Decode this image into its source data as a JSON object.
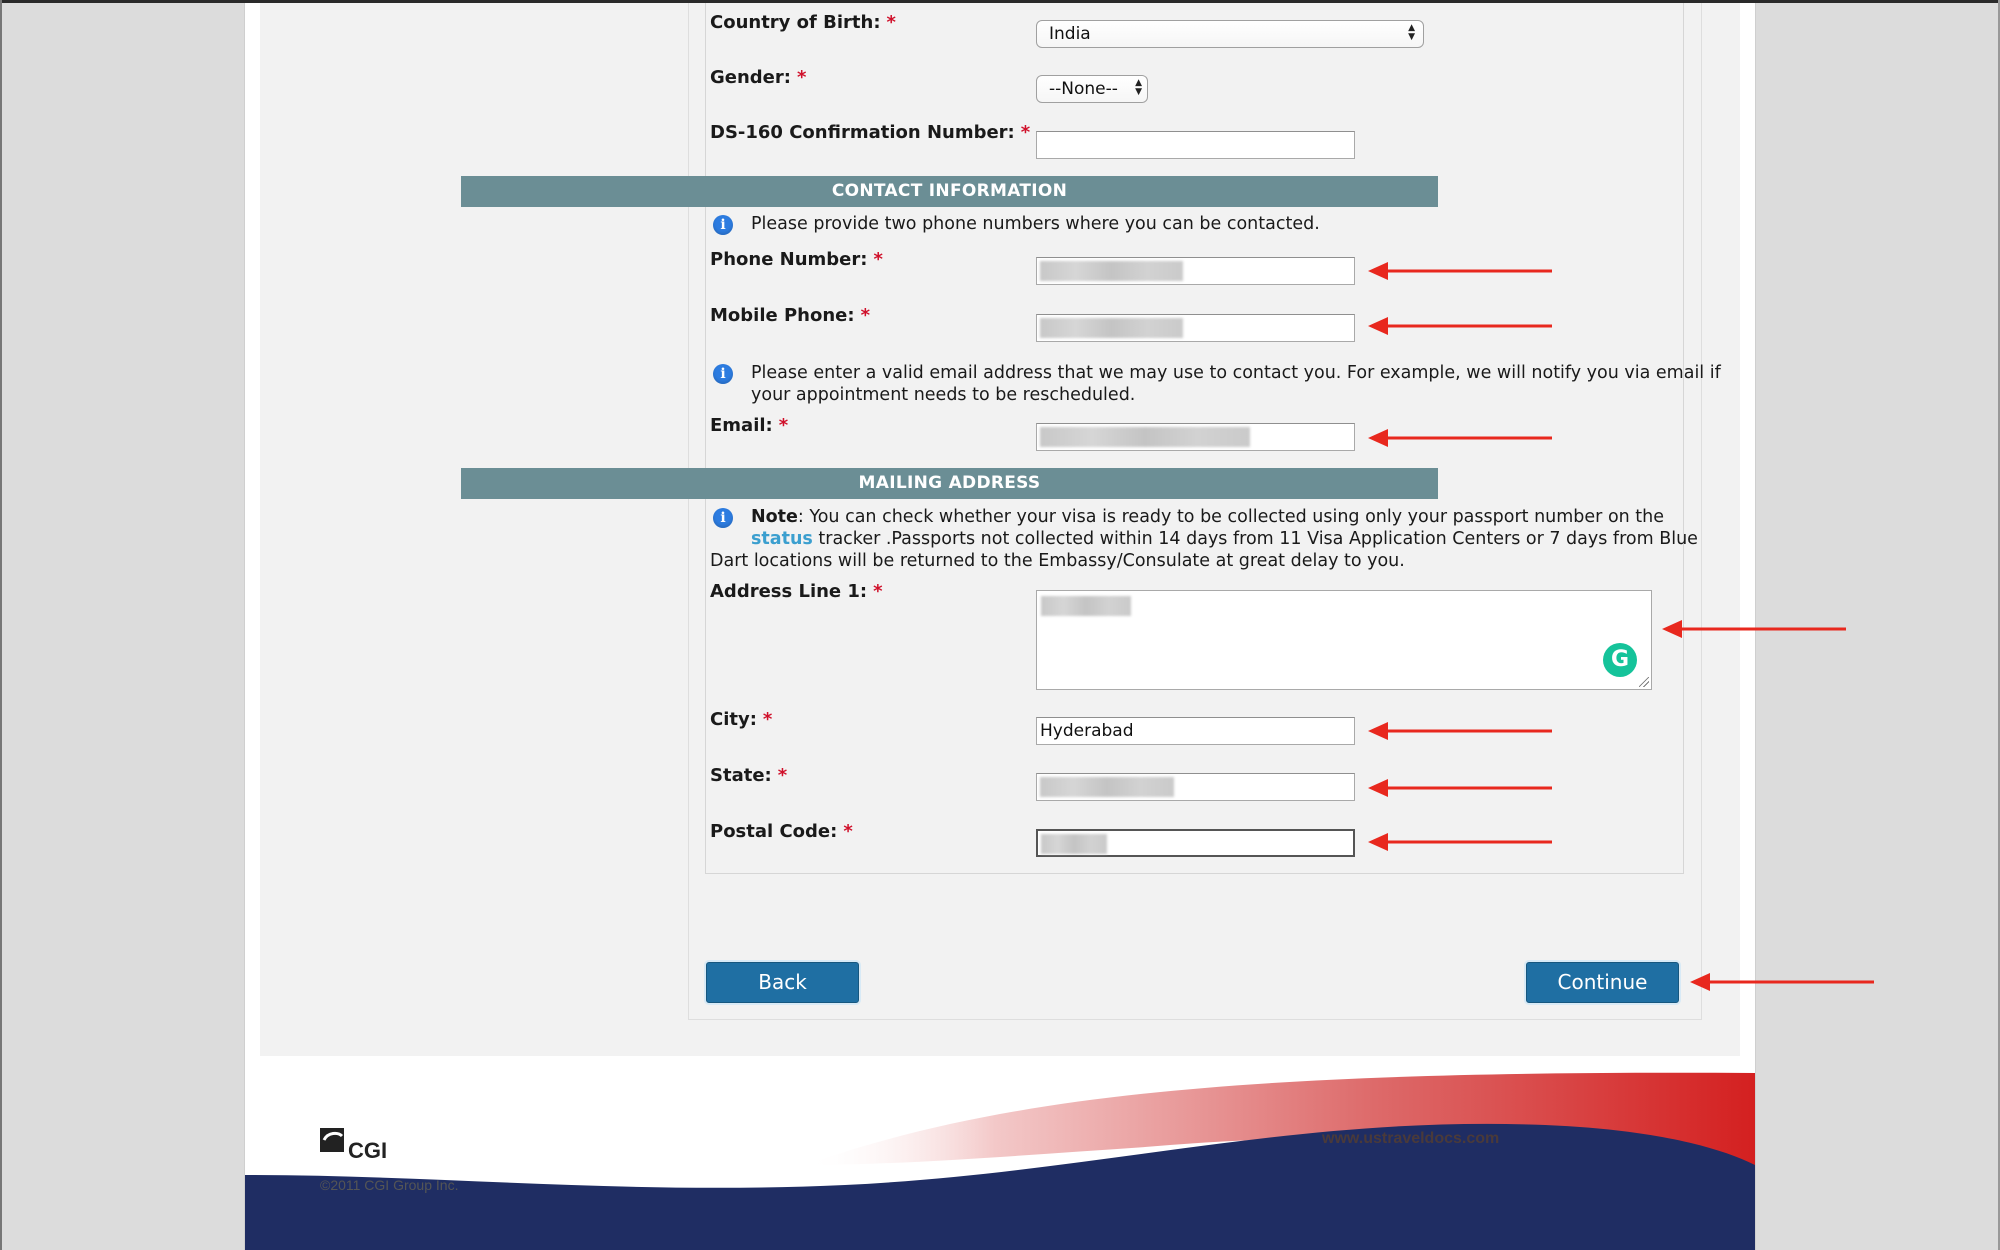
{
  "form": {
    "country_of_birth": {
      "label": "Country of Birth:",
      "required": "*",
      "value": "India"
    },
    "gender": {
      "label": "Gender:",
      "required": "*",
      "value": "--None--"
    },
    "ds160": {
      "label": "DS-160 Confirmation Number:",
      "required": "*",
      "value": ""
    }
  },
  "contact": {
    "header": "CONTACT INFORMATION",
    "phone_info": "Please provide two phone numbers where you can be contacted.",
    "phone": {
      "label": "Phone Number:",
      "required": "*",
      "value_state": "redacted"
    },
    "mobile": {
      "label": "Mobile Phone:",
      "required": "*",
      "value_state": "redacted"
    },
    "email_info_line1": "Please enter a valid email address that we may use to contact you. For example, we will notify you via email if",
    "email_info_line2": "your appointment needs to be rescheduled.",
    "email": {
      "label": "Email:",
      "required": "*",
      "value_state": "redacted"
    }
  },
  "mailing": {
    "header": "MAILING ADDRESS",
    "note_label": "Note",
    "note_part1": ": You can check whether your visa is ready to be collected using only your passport number on the",
    "status_link": "status",
    "note_part2": " tracker .Passports not collected within 14 days from 11 Visa Application Centers or 7 days from Blue",
    "note_part3": "Dart locations will be returned to the Embassy/Consulate at great delay to you.",
    "address1": {
      "label": "Address Line 1:",
      "required": "*",
      "value_state": "redacted"
    },
    "city": {
      "label": "City:",
      "required": "*",
      "value": "Hyderabad"
    },
    "state": {
      "label": "State:",
      "required": "*",
      "value_state": "redacted"
    },
    "postal": {
      "label": "Postal Code:",
      "required": "*",
      "value_state": "redacted"
    }
  },
  "buttons": {
    "back": "Back",
    "continue": "Continue"
  },
  "grammarly_glyph": "G",
  "footer": {
    "logo_text": "CGI",
    "copyright": "©2011 CGI Group Inc.",
    "site_url": "www.ustraveldocs.com"
  },
  "colors": {
    "section_header": "#6b8e95",
    "button": "#1f6fa3",
    "required": "#d0112b",
    "annotation_arrow": "#e8281e",
    "link": "#3b9fcf",
    "footer_navy": "#1f2d63",
    "footer_red": "#d42a2a"
  }
}
